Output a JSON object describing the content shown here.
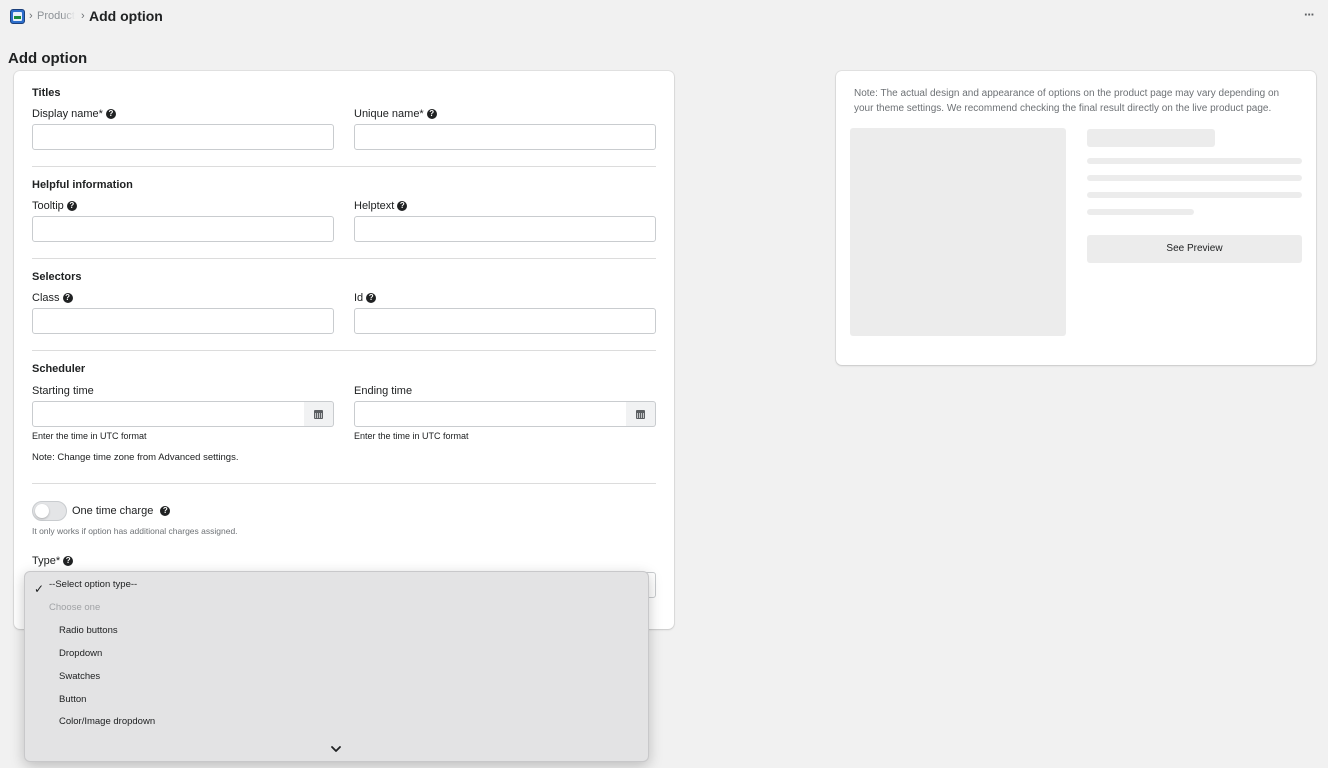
{
  "breadcrumb": {
    "app_icon": "app-logo-icon",
    "separator": "›",
    "parent": "Product",
    "current": "Add option"
  },
  "more_actions_label": "···",
  "page_title": "Add option",
  "form": {
    "titles": {
      "heading": "Titles",
      "display_name_label": "Display name*",
      "display_name_value": "",
      "unique_name_label": "Unique name*",
      "unique_name_value": ""
    },
    "helpful": {
      "heading": "Helpful information",
      "tooltip_label": "Tooltip",
      "tooltip_value": "",
      "helptext_label": "Helptext",
      "helptext_value": ""
    },
    "selectors": {
      "heading": "Selectors",
      "class_label": "Class",
      "class_value": "",
      "id_label": "Id",
      "id_value": ""
    },
    "scheduler": {
      "heading": "Scheduler",
      "start_label": "Starting time",
      "start_hint": "Enter the time in UTC format",
      "end_label": "Ending time",
      "end_hint": "Enter the time in UTC format",
      "note": "Note: Change time zone from Advanced settings."
    },
    "one_time_charge": {
      "label": "One time charge",
      "enabled": false,
      "note": "It only works if option has additional charges assigned."
    },
    "type": {
      "label": "Type*",
      "selected": "--Select option type--",
      "options": [
        {
          "label": "--Select option type--",
          "selected": true,
          "disabled": false
        },
        {
          "label": "Choose one",
          "selected": false,
          "disabled": true
        },
        {
          "label": "Radio buttons",
          "selected": false,
          "disabled": false
        },
        {
          "label": "Dropdown",
          "selected": false,
          "disabled": false
        },
        {
          "label": "Swatches",
          "selected": false,
          "disabled": false
        },
        {
          "label": "Button",
          "selected": false,
          "disabled": false
        },
        {
          "label": "Color/Image dropdown",
          "selected": false,
          "disabled": false
        }
      ]
    }
  },
  "preview": {
    "note": "Note: The actual design and appearance of options on the product page may vary depending on your theme settings. We recommend checking the final result directly on the live product page.",
    "button_label": "See Preview"
  },
  "icons": {
    "help": "question-circle-icon",
    "calendar": "calendar-icon",
    "check": "checkmark-icon",
    "chevron": "chevron-down-icon"
  },
  "colors": {
    "background": "#f1f1f1",
    "card": "#ffffff",
    "placeholder": "#ececec",
    "dropdown_menu": "#e3e3e4"
  }
}
